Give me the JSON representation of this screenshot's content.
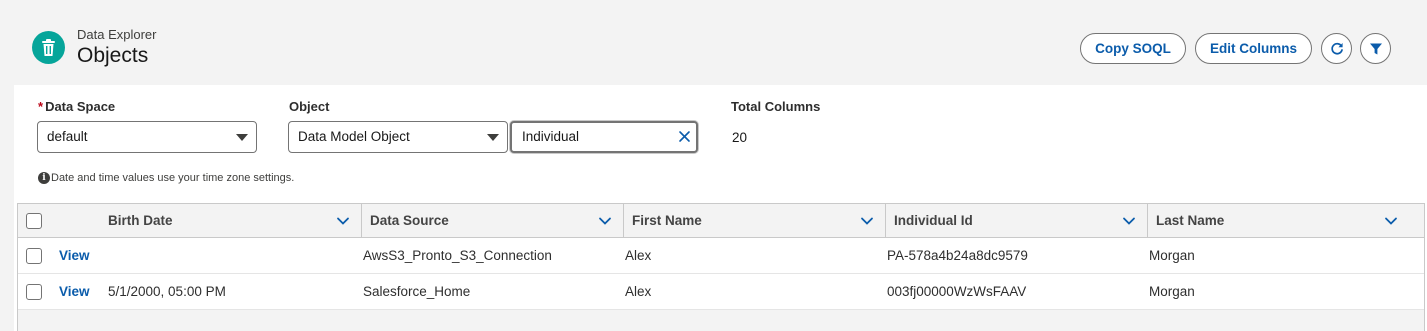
{
  "header": {
    "breadcrumb": "Data Explorer",
    "title": "Objects",
    "app_icon": "trash-bin-icon",
    "accent_color": "#06a59a",
    "buttons": {
      "copy_soql": "Copy SOQL",
      "edit_columns": "Edit Columns"
    },
    "icon_buttons": [
      "refresh-icon",
      "filter-icon"
    ]
  },
  "filters": {
    "data_space": {
      "label": "Data Space",
      "required_marker": "*",
      "value": "default"
    },
    "object": {
      "label": "Object",
      "type_value": "Data Model Object",
      "search_value": "Individual"
    },
    "total_columns": {
      "label": "Total Columns",
      "value": "20"
    },
    "note": "Date and time values use your time zone settings."
  },
  "table": {
    "columns": [
      "Birth Date",
      "Data Source",
      "First Name",
      "Individual Id",
      "Last Name"
    ],
    "rows": [
      {
        "action": "View",
        "birth_date": "",
        "data_source": "AwsS3_Pronto_S3_Connection",
        "first_name": "Alex",
        "individual_id": "PA-578a4b24a8dc9579",
        "last_name": "Morgan"
      },
      {
        "action": "View",
        "birth_date": "5/1/2000, 05:00 PM",
        "data_source": "Salesforce_Home",
        "first_name": "Alex",
        "individual_id": "003fj00000WzWsFAAV",
        "last_name": "Morgan"
      }
    ]
  }
}
